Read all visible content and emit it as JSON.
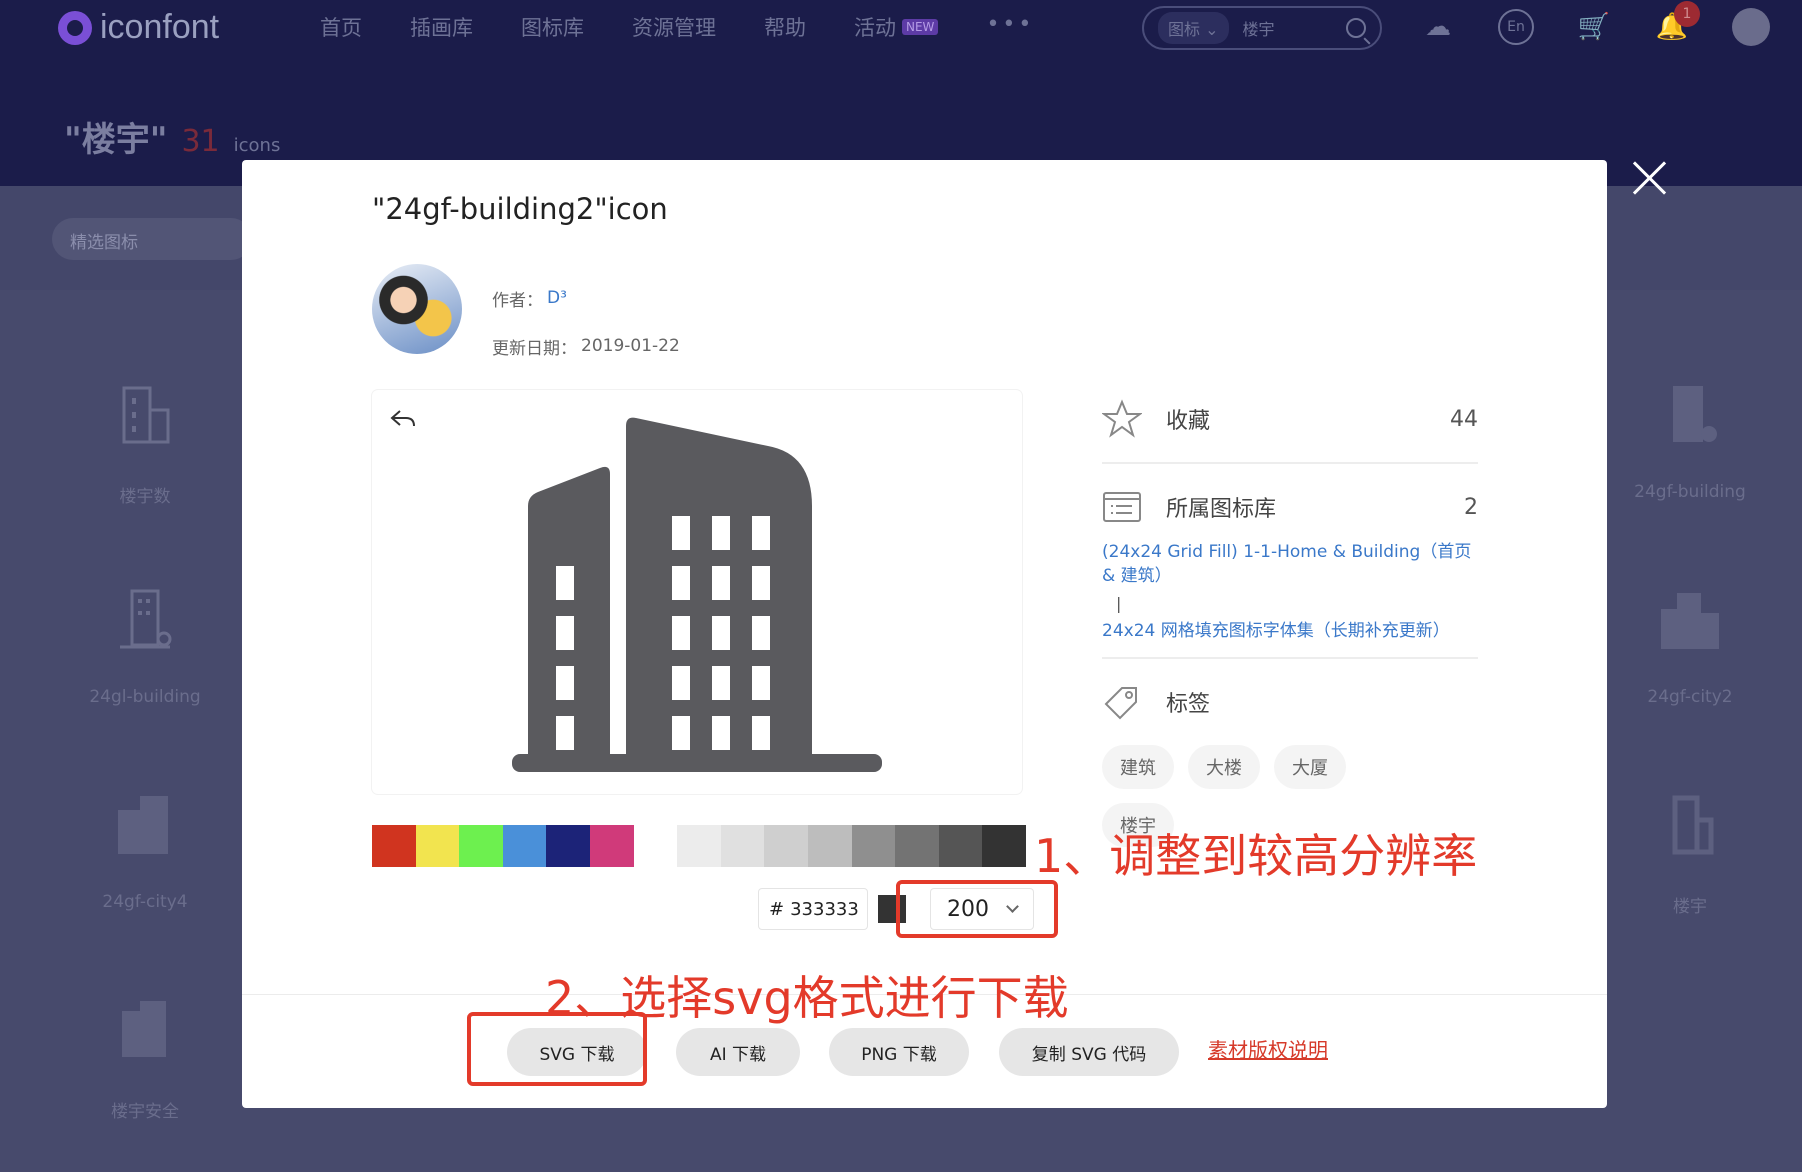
{
  "header": {
    "logo_text": "iconfont",
    "nav": [
      "首页",
      "插画库",
      "图标库",
      "资源管理",
      "帮助",
      "活动"
    ],
    "new_badge": "NEW",
    "more": "•••",
    "search_type": "图标 ⌄",
    "search_value": "楼宇",
    "lang_label": "En",
    "notification_count": "1"
  },
  "page": {
    "title": "\"楼宇\"",
    "count": "31",
    "unit": "icons",
    "filter": "精选图标"
  },
  "bg_icons": [
    {
      "label": "楼宇数"
    },
    {
      "label": "24gl-building"
    },
    {
      "label": "24gf-city4"
    },
    {
      "label": "楼宇安全"
    },
    {
      "label": "24gf-building"
    },
    {
      "label": "24gf-city2"
    },
    {
      "label": "楼宇"
    }
  ],
  "modal": {
    "title": "\"24gf-building2\"icon",
    "author_label": "作者：",
    "author_name": "D³",
    "date_label": "更新日期：",
    "date": "2019-01-22",
    "swatches": [
      "#d0341f",
      "#f2e44f",
      "#6df04f",
      "#4a90d9",
      "#1c2378",
      "#d03a7a",
      "#ffffff",
      "#ececec",
      "#e0e0e0",
      "#cfcfcf",
      "#bdbdbd",
      "#8f8f8f",
      "#737373",
      "#555555",
      "#333333"
    ],
    "hex_prefix": "#",
    "hex_value": "333333",
    "size_value": "200",
    "fav_label": "收藏",
    "fav_count": "44",
    "lib_label": "所属图标库",
    "lib_count": "2",
    "lib_link_1": "(24x24 Grid Fill) 1-1-Home & Building（首页 & 建筑）",
    "pipe": "|",
    "lib_link_2": "24x24 网格填充图标字体集（长期补充更新）",
    "tags_label": "标签",
    "tags": [
      "建筑",
      "大楼",
      "大厦",
      "楼宇"
    ],
    "buttons": {
      "svg": "SVG 下载",
      "ai": "AI 下载",
      "png": "PNG 下载",
      "copy": "复制 SVG 代码"
    },
    "copyright": "素材版权说明"
  },
  "annotations": {
    "step1": "1、调整到较高分辨率",
    "step2": "2、选择svg格式进行下载"
  }
}
